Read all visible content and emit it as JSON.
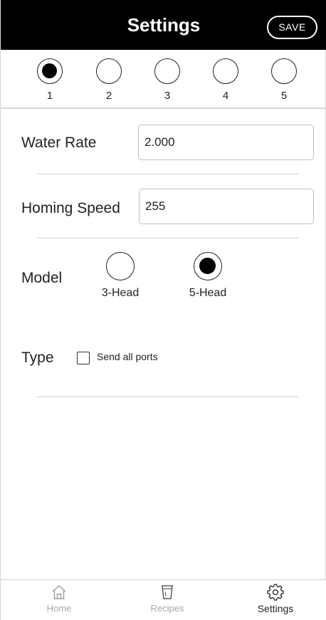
{
  "header": {
    "title": "Settings",
    "save_label": "SAVE"
  },
  "profiles": [
    {
      "label": "1",
      "selected": true
    },
    {
      "label": "2",
      "selected": false
    },
    {
      "label": "3",
      "selected": false
    },
    {
      "label": "4",
      "selected": false
    },
    {
      "label": "5",
      "selected": false
    }
  ],
  "form": {
    "water_rate": {
      "label": "Water Rate",
      "value": "2.000"
    },
    "homing_speed": {
      "label": "Homing Speed",
      "value": "255"
    },
    "model": {
      "label": "Model",
      "options": [
        {
          "label": "3-Head",
          "selected": false
        },
        {
          "label": "5-Head",
          "selected": true
        }
      ]
    },
    "type": {
      "label": "Type",
      "checkbox_label": "Send all ports",
      "checked": false
    }
  },
  "bottom_nav": {
    "items": [
      {
        "label": "Home",
        "icon": "home-icon",
        "active": false
      },
      {
        "label": "Recipes",
        "icon": "recipes-cup-icon",
        "active": false
      },
      {
        "label": "Settings",
        "icon": "gear-icon",
        "active": true
      }
    ]
  }
}
